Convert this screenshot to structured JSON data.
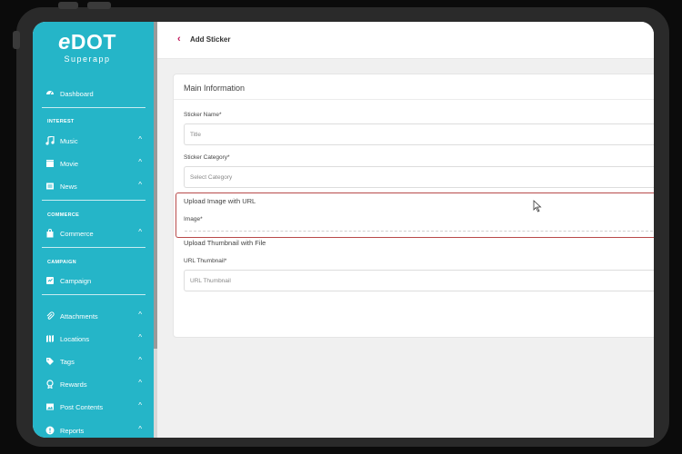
{
  "logo": {
    "main": "DOT",
    "e": "e",
    "sub": "Superapp"
  },
  "sidebar": {
    "dashboard": "Dashboard",
    "sections": {
      "interest": "INTEREST",
      "commerce": "COMMERCE",
      "campaign": "CAMPAIGN"
    },
    "items": {
      "music": "Music",
      "movie": "Movie",
      "news": "News",
      "commerce": "Commerce",
      "campaign": "Campaign",
      "attachments": "Attachments",
      "locations": "Locations",
      "tags": "Tags",
      "rewards": "Rewards",
      "post_contents": "Post Contents",
      "reports": "Reports"
    }
  },
  "topbar": {
    "title": "Add Sticker"
  },
  "form": {
    "card_title": "Main Information",
    "sticker_name_label": "Sticker Name*",
    "sticker_name_placeholder": "Title",
    "sticker_category_label": "Sticker Category*",
    "sticker_category_placeholder": "Select Category",
    "upload_url_title": "Upload Image with URL",
    "image_label": "Image*",
    "upload_thumb_title": "Upload Thumbnail with File",
    "url_thumb_label": "URL Thumbnail*",
    "url_thumb_placeholder": "URL Thumbnail"
  },
  "colors": {
    "sidebar": "#25b5c8",
    "accent": "#c2185b",
    "highlight": "#b84a4a"
  }
}
